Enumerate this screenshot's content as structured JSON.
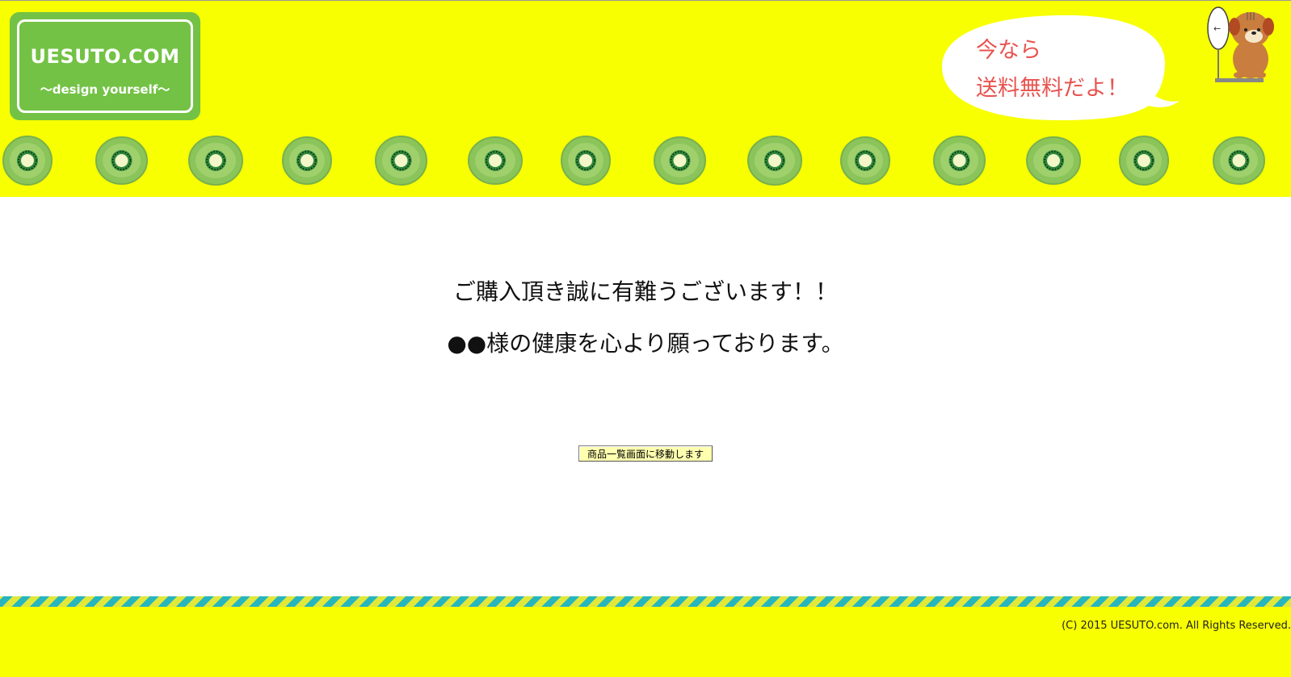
{
  "header": {
    "logo_title": "UESUTO.COM",
    "logo_tagline": "〜design yourself〜",
    "bubble_line1": "今なら",
    "bubble_line2": "送料無料だよ！",
    "kiwi_count": 14
  },
  "main": {
    "thanks_line1": "ご購入頂き誠に有難うございます！！",
    "thanks_line2": "●●様の健康を心より願っております。",
    "goto_button_label": "商品一覧画面に移動します"
  },
  "footer": {
    "copyright": "(C) 2015 UESUTO.com. All Rights Reserved."
  },
  "colors": {
    "header_bg": "#f7ff00",
    "logo_green": "#73c245",
    "bubble_text": "#e8534f",
    "kiwi_green": "#8ac45a",
    "stripe_yellow": "#e1e83a",
    "stripe_teal": "#27b6bd",
    "button_bg": "#ffffb0"
  }
}
